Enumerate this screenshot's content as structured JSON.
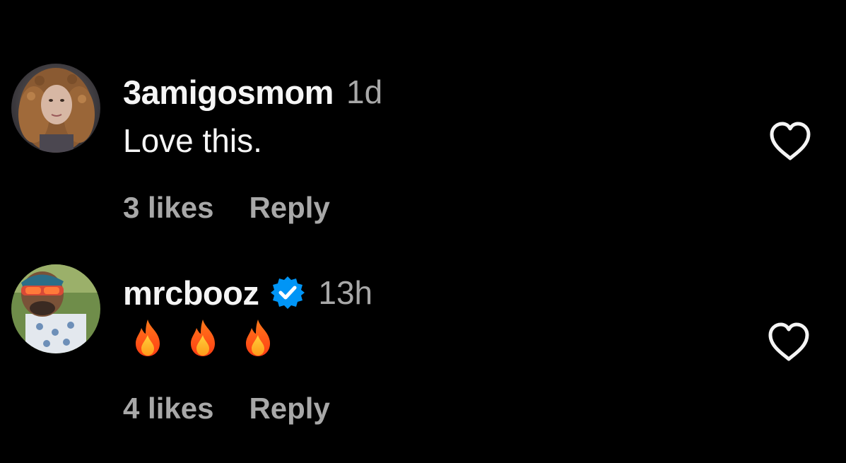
{
  "comments": [
    {
      "username": "3amigosmom",
      "timestamp": "1d",
      "verified": false,
      "text": "Love this.",
      "likes_label": "3 likes",
      "reply_label": "Reply",
      "avatar_icon": "avatar-photo"
    },
    {
      "username": "mrcbooz",
      "timestamp": "13h",
      "verified": true,
      "text": "🔥🔥🔥",
      "likes_label": "4 likes",
      "reply_label": "Reply",
      "avatar_icon": "avatar-photo"
    }
  ],
  "colors": {
    "background": "#000000",
    "primary_text": "#f5f5f5",
    "secondary_text": "#a8a8a8",
    "verified_blue": "#0095f6"
  },
  "icons": {
    "like": "heart-outline-icon",
    "verified": "verified-badge-icon",
    "fire": "fire-emoji-icon"
  }
}
